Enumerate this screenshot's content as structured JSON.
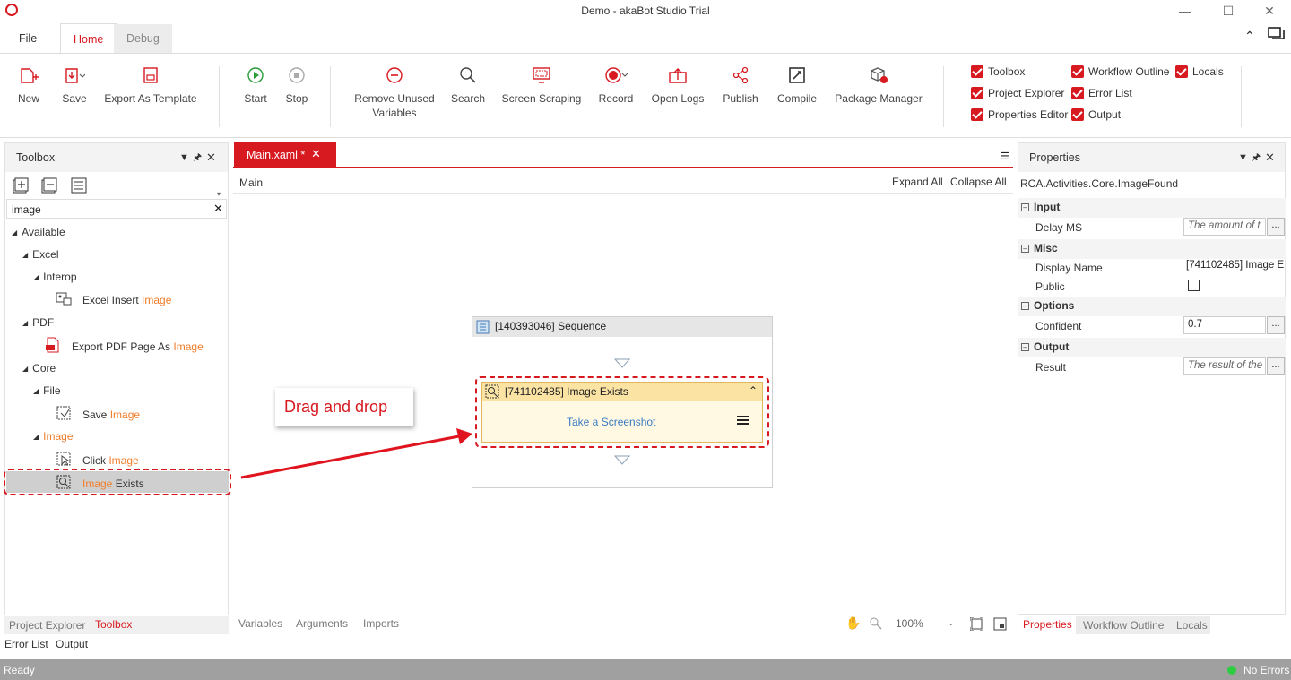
{
  "window": {
    "title": "Demo - akaBot Studio Trial"
  },
  "ribbon_tabs": [
    "File",
    "Home",
    "Debug"
  ],
  "ribbon_buttons": {
    "new": "New",
    "save": "Save",
    "export_template": "Export As Template",
    "start": "Start",
    "stop": "Stop",
    "remove_unused_1": "Remove Unused",
    "remove_unused_2": "Variables",
    "search": "Search",
    "screen_scraping": "Screen Scraping",
    "record": "Record",
    "open_logs": "Open Logs",
    "publish": "Publish",
    "compile": "Compile",
    "package_manager": "Package Manager"
  },
  "view_toggles": {
    "toolbox": "Toolbox",
    "project_explorer": "Project Explorer",
    "properties_editor": "Properties Editor",
    "workflow_outline": "Workflow Outline",
    "error_list": "Error List",
    "output": "Output",
    "locals": "Locals"
  },
  "toolbox": {
    "title": "Toolbox",
    "search_value": "image",
    "tree": {
      "available": "Available",
      "excel": "Excel",
      "interop": "Interop",
      "excel_insert": "Excel Insert ",
      "excel_insert_hl": "Image",
      "pdf": "PDF",
      "export_pdf": "Export PDF Page As ",
      "export_pdf_hl": "Image",
      "core": "Core",
      "file": "File",
      "save_image": "Save ",
      "save_image_hl": "Image",
      "image_cat": "Image",
      "click_image": "Click ",
      "click_image_hl": "Image",
      "image_exists_hl": "Image",
      "image_exists": " Exists"
    },
    "bottom_tabs": {
      "project_explorer": "Project Explorer",
      "toolbox": "Toolbox"
    }
  },
  "bottom_left_tabs": {
    "error_list": "Error List",
    "output": "Output"
  },
  "editor": {
    "tab_label": "Main.xaml *",
    "breadcrumb": "Main",
    "expand_all": "Expand All",
    "collapse_all": "Collapse All",
    "sequence_title": "[140393046] Sequence",
    "activity_title": "[741102485] Image Exists",
    "activity_link": "Take a Screenshot",
    "callout": "Drag and drop",
    "bottom_tabs": {
      "variables": "Variables",
      "arguments": "Arguments",
      "imports": "Imports"
    },
    "zoom": "100%"
  },
  "properties": {
    "title": "Properties",
    "type": "RCA.Activities.Core.ImageFound",
    "groups": {
      "input": "Input",
      "misc": "Misc",
      "options": "Options",
      "output": "Output"
    },
    "delay_ms_label": "Delay MS",
    "delay_ms_placeholder": "The amount of t",
    "display_name_label": "Display Name",
    "display_name_value": "[741102485] Image E",
    "public_label": "Public",
    "confident_label": "Confident",
    "confident_value": "0.7",
    "result_label": "Result",
    "result_placeholder": "The result of the",
    "bottom_tabs": {
      "properties": "Properties",
      "workflow_outline": "Workflow Outline",
      "locals": "Locals"
    }
  },
  "status": {
    "left": "Ready",
    "right": "No Errors"
  },
  "colors": {
    "accent": "#d71920",
    "highlight": "#f07d2a",
    "activity_header": "#fbe3a3",
    "status_bar": "#a0a0a0"
  }
}
